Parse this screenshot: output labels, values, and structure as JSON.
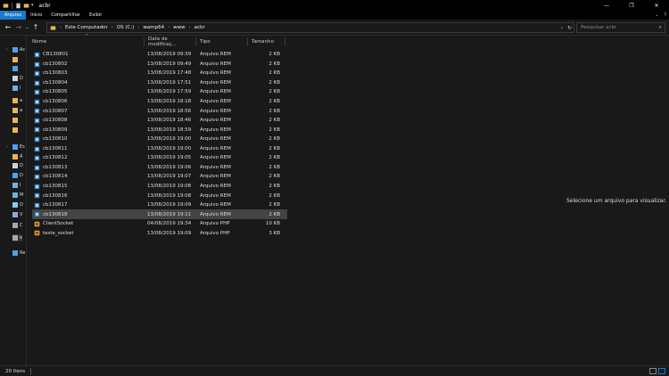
{
  "window": {
    "title": "acbr",
    "minimize": "—",
    "maximize": "❐",
    "close": "✕"
  },
  "ribbon": {
    "tabs": [
      "Arquivo",
      "Início",
      "Compartilhar",
      "Exibir"
    ],
    "active_tab": "Arquivo"
  },
  "nav": {
    "breadcrumb": [
      "Este Computador",
      "OS (C:)",
      "wamp64",
      "www",
      "acbr"
    ],
    "search_placeholder": "Pesquisar acbr"
  },
  "sidebar": {
    "items": [
      {
        "label": "Ac",
        "icon": "star-icon"
      },
      {
        "label": "",
        "icon": "folder-icon"
      },
      {
        "label": "",
        "icon": "download-icon"
      },
      {
        "label": "D",
        "icon": "document-icon"
      },
      {
        "label": "I",
        "icon": "image-icon"
      },
      {
        "label": "a",
        "icon": "folder-icon"
      },
      {
        "label": "a",
        "icon": "folder-icon"
      },
      {
        "label": "",
        "icon": "folder-icon"
      },
      {
        "label": "",
        "icon": "folder-icon"
      },
      {
        "label": "Es",
        "icon": "computer-icon"
      },
      {
        "label": "Á",
        "icon": "folder-icon"
      },
      {
        "label": "D",
        "icon": "document-icon"
      },
      {
        "label": "D",
        "icon": "download-icon"
      },
      {
        "label": "I",
        "icon": "image-icon"
      },
      {
        "label": "M",
        "icon": "music-icon"
      },
      {
        "label": "O",
        "icon": "cube-icon"
      },
      {
        "label": "V",
        "icon": "video-icon"
      },
      {
        "label": "C",
        "icon": "drive-icon"
      },
      {
        "label": "e",
        "icon": "drive-icon"
      },
      {
        "label": "Re",
        "icon": "network-icon"
      }
    ]
  },
  "columns": {
    "name": "Nome",
    "date": "Data de modificaç...",
    "type": "Tipo",
    "size": "Tamanho"
  },
  "files": [
    {
      "name": "CB130801",
      "date": "13/08/2019 09:39",
      "type": "Arquivo REM",
      "size": "2 KB",
      "kind": "rem"
    },
    {
      "name": "cb130802",
      "date": "13/08/2019 09:49",
      "type": "Arquivo REM",
      "size": "2 KB",
      "kind": "rem"
    },
    {
      "name": "cb130803",
      "date": "13/08/2019 17:48",
      "type": "Arquivo REM",
      "size": "2 KB",
      "kind": "rem"
    },
    {
      "name": "cb130804",
      "date": "13/08/2019 17:51",
      "type": "Arquivo REM",
      "size": "2 KB",
      "kind": "rem"
    },
    {
      "name": "cb130805",
      "date": "13/08/2019 17:59",
      "type": "Arquivo REM",
      "size": "2 KB",
      "kind": "rem"
    },
    {
      "name": "cb130806",
      "date": "13/08/2019 18:18",
      "type": "Arquivo REM",
      "size": "2 KB",
      "kind": "rem"
    },
    {
      "name": "cb130807",
      "date": "13/08/2019 18:56",
      "type": "Arquivo REM",
      "size": "2 KB",
      "kind": "rem"
    },
    {
      "name": "cb130808",
      "date": "13/08/2019 18:46",
      "type": "Arquivo REM",
      "size": "2 KB",
      "kind": "rem"
    },
    {
      "name": "cb130809",
      "date": "13/08/2019 18:59",
      "type": "Arquivo REM",
      "size": "2 KB",
      "kind": "rem"
    },
    {
      "name": "cb130810",
      "date": "13/08/2019 19:00",
      "type": "Arquivo REM",
      "size": "2 KB",
      "kind": "rem"
    },
    {
      "name": "cb130811",
      "date": "13/08/2019 19:00",
      "type": "Arquivo REM",
      "size": "2 KB",
      "kind": "rem"
    },
    {
      "name": "cb130812",
      "date": "13/08/2019 19:05",
      "type": "Arquivo REM",
      "size": "2 KB",
      "kind": "rem"
    },
    {
      "name": "cb130813",
      "date": "13/08/2019 19:06",
      "type": "Arquivo REM",
      "size": "2 KB",
      "kind": "rem"
    },
    {
      "name": "cb130814",
      "date": "13/08/2019 19:07",
      "type": "Arquivo REM",
      "size": "2 KB",
      "kind": "rem"
    },
    {
      "name": "cb130815",
      "date": "13/08/2019 19:08",
      "type": "Arquivo REM",
      "size": "2 KB",
      "kind": "rem"
    },
    {
      "name": "cb130816",
      "date": "13/08/2019 19:08",
      "type": "Arquivo REM",
      "size": "2 KB",
      "kind": "rem"
    },
    {
      "name": "cb130817",
      "date": "13/08/2019 19:09",
      "type": "Arquivo REM",
      "size": "2 KB",
      "kind": "rem"
    },
    {
      "name": "cb130818",
      "date": "13/08/2019 19:11",
      "type": "Arquivo REM",
      "size": "2 KB",
      "kind": "rem",
      "selected": true
    },
    {
      "name": "ClientSocket",
      "date": "04/08/2019 19:34",
      "type": "Arquivo PHP",
      "size": "10 KB",
      "kind": "php"
    },
    {
      "name": "teste_socket",
      "date": "13/08/2019 19:09",
      "type": "Arquivo PHP",
      "size": "3 KB",
      "kind": "php"
    }
  ],
  "preview": {
    "message": "Selecione um arquivo para visualizar."
  },
  "status": {
    "count": "20 itens"
  },
  "colors": {
    "accent": "#1979ca",
    "folder": "#e8b84a",
    "background": "#191919"
  }
}
